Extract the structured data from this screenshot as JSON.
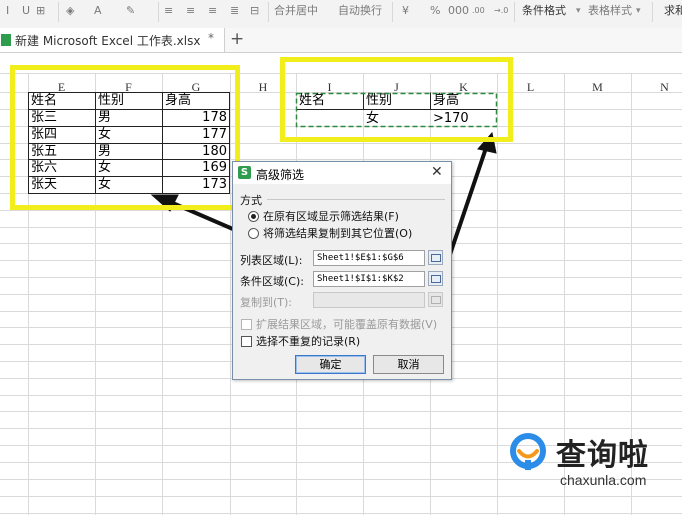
{
  "toolbar": {
    "merge_center": "合并居中",
    "auto_wrap": "自动换行",
    "percent": "%",
    "thousands": "000",
    "dec_up": ".00",
    "dec_down": "→.0",
    "conditional_format": "条件格式",
    "table_style": "表格样式",
    "sum": "求和"
  },
  "tabs": {
    "file_tab": "新建 Microsoft Excel 工作表.xlsx",
    "close_glyph": "*",
    "new_tab_glyph": "+"
  },
  "columns": [
    "E",
    "F",
    "G",
    "H",
    "I",
    "J",
    "K",
    "L",
    "M",
    "N"
  ],
  "list_range": {
    "headers": [
      "姓名",
      "性别",
      "身高"
    ],
    "rows": [
      [
        "张三",
        "男",
        "178"
      ],
      [
        "张四",
        "女",
        "177"
      ],
      [
        "张五",
        "男",
        "180"
      ],
      [
        "张六",
        "女",
        "169"
      ],
      [
        "张天",
        "女",
        "173"
      ]
    ]
  },
  "criteria_range": {
    "headers": [
      "姓名",
      "性别",
      "身高"
    ],
    "row": [
      "",
      "女",
      ">170"
    ]
  },
  "dialog": {
    "title": "高级筛选",
    "close": "✕",
    "section_method": "方式",
    "opt_in_place": "在原有区域显示筛选结果(F)",
    "opt_copy": "将筛选结果复制到其它位置(O)",
    "list_range_label": "列表区域(L):",
    "list_range_value": "Sheet1!$E$1:$G$6",
    "criteria_range_label": "条件区域(C):",
    "criteria_range_value": "Sheet1!$I$1:$K$2",
    "copy_to_label": "复制到(T):",
    "copy_to_value": "",
    "expand_label": "扩展结果区域，可能覆盖原有数据(V)",
    "unique_label": "选择不重复的记录(R)",
    "ok": "确定",
    "cancel": "取消"
  },
  "watermark": {
    "brand": "查询啦",
    "url": "chaxunla.com"
  },
  "colors": {
    "highlight": "#f2ee1b",
    "arrow": "#111111",
    "logo_blue": "#2b8de8",
    "logo_orange": "#f39a1d"
  }
}
